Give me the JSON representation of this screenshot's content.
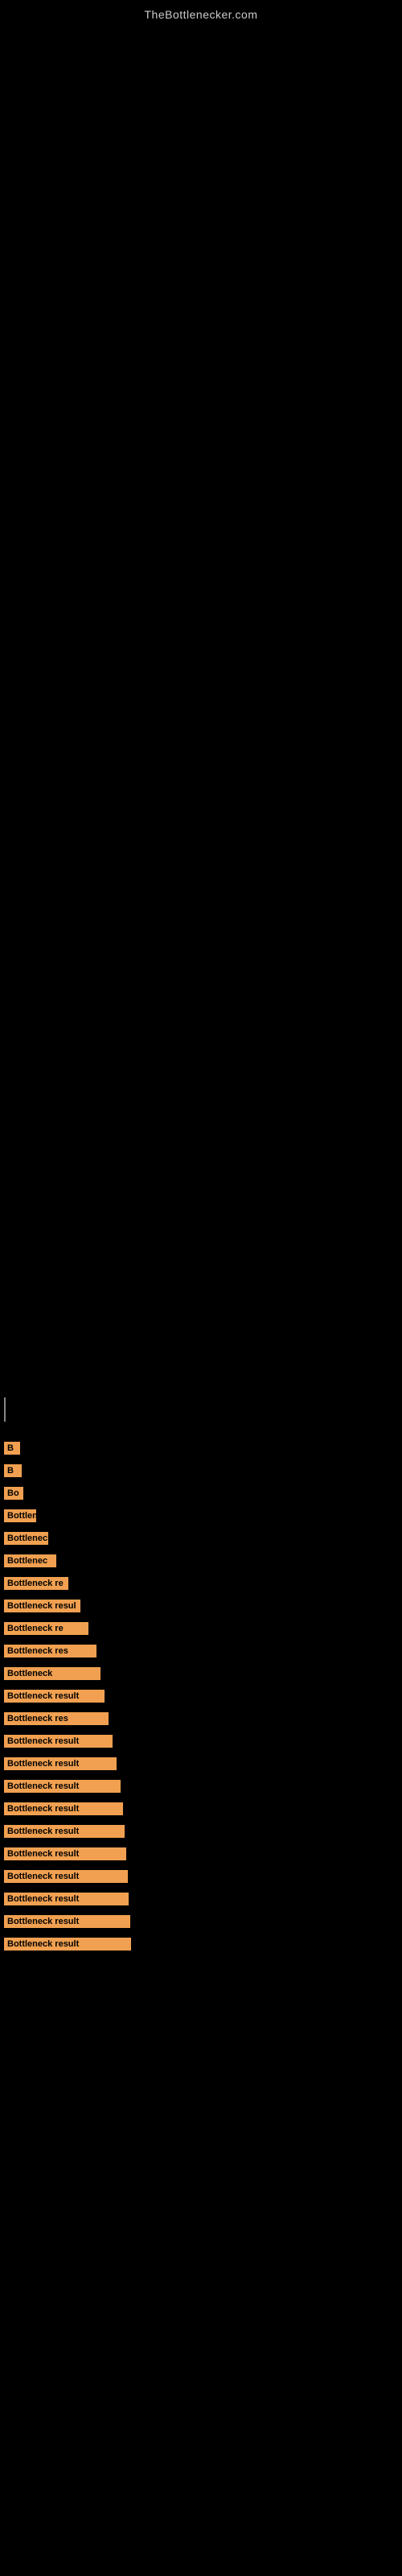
{
  "site": {
    "title": "TheBottlenecker.com"
  },
  "bottleneck_items": [
    {
      "id": 1,
      "label": "B",
      "bar_class": "bar-w-1"
    },
    {
      "id": 2,
      "label": "B",
      "bar_class": "bar-w-2"
    },
    {
      "id": 3,
      "label": "Bo",
      "bar_class": "bar-w-3"
    },
    {
      "id": 4,
      "label": "Bottlen",
      "bar_class": "bar-w-4"
    },
    {
      "id": 5,
      "label": "Bottleneck r",
      "bar_class": "bar-w-5"
    },
    {
      "id": 6,
      "label": "Bottlenec",
      "bar_class": "bar-w-6"
    },
    {
      "id": 7,
      "label": "Bottleneck re",
      "bar_class": "bar-w-7"
    },
    {
      "id": 8,
      "label": "Bottleneck resul",
      "bar_class": "bar-w-8"
    },
    {
      "id": 9,
      "label": "Bottleneck re",
      "bar_class": "bar-w-9"
    },
    {
      "id": 10,
      "label": "Bottleneck res",
      "bar_class": "bar-w-10"
    },
    {
      "id": 11,
      "label": "Bottleneck",
      "bar_class": "bar-w-11"
    },
    {
      "id": 12,
      "label": "Bottleneck result",
      "bar_class": "bar-w-12"
    },
    {
      "id": 13,
      "label": "Bottleneck res",
      "bar_class": "bar-w-13"
    },
    {
      "id": 14,
      "label": "Bottleneck result",
      "bar_class": "bar-w-14"
    },
    {
      "id": 15,
      "label": "Bottleneck result",
      "bar_class": "bar-w-15"
    },
    {
      "id": 16,
      "label": "Bottleneck result",
      "bar_class": "bar-w-16"
    },
    {
      "id": 17,
      "label": "Bottleneck result",
      "bar_class": "bar-w-17"
    },
    {
      "id": 18,
      "label": "Bottleneck result",
      "bar_class": "bar-w-18"
    },
    {
      "id": 19,
      "label": "Bottleneck result",
      "bar_class": "bar-w-19"
    },
    {
      "id": 20,
      "label": "Bottleneck result",
      "bar_class": "bar-w-20"
    },
    {
      "id": 21,
      "label": "Bottleneck result",
      "bar_class": "bar-w-21"
    },
    {
      "id": 22,
      "label": "Bottleneck result",
      "bar_class": "bar-w-22"
    },
    {
      "id": 23,
      "label": "Bottleneck result",
      "bar_class": "bar-w-23"
    }
  ]
}
